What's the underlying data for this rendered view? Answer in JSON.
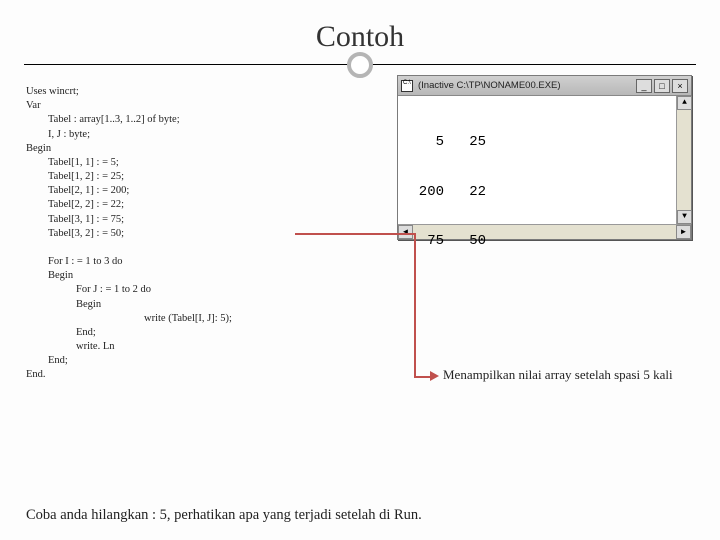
{
  "title": "Contoh",
  "code_lines": [
    {
      "cls": "",
      "text": "Uses wincrt;"
    },
    {
      "cls": "",
      "text": "Var"
    },
    {
      "cls": "ind1",
      "text": "Tabel : array[1..3, 1..2] of byte;"
    },
    {
      "cls": "ind1",
      "text": "I, J : byte;"
    },
    {
      "cls": "",
      "text": "Begin"
    },
    {
      "cls": "ind1",
      "text": "Tabel[1, 1] : = 5;"
    },
    {
      "cls": "ind1",
      "text": "Tabel[1, 2] : = 25;"
    },
    {
      "cls": "ind1",
      "text": "Tabel[2, 1] : = 200;"
    },
    {
      "cls": "ind1",
      "text": "Tabel[2, 2] : = 22;"
    },
    {
      "cls": "ind1",
      "text": "Tabel[3, 1] : = 75;"
    },
    {
      "cls": "ind1",
      "text": "Tabel[3, 2] : = 50;"
    },
    {
      "cls": "",
      "text": " "
    },
    {
      "cls": "ind1",
      "text": "For I : = 1 to 3 do"
    },
    {
      "cls": "ind1",
      "text": "Begin"
    },
    {
      "cls": "ind2",
      "text": "For J : = 1 to 2 do"
    },
    {
      "cls": "ind2",
      "text": "Begin"
    },
    {
      "cls": "ind4",
      "text": "write (Tabel[I, J]: 5);"
    },
    {
      "cls": "ind2",
      "text": "End;"
    },
    {
      "cls": "ind2",
      "text": "write. Ln"
    },
    {
      "cls": "ind1",
      "text": "End;"
    },
    {
      "cls": "",
      "text": "End."
    }
  ],
  "console": {
    "title": "(Inactive C:\\TP\\NONAME00.EXE)",
    "rows": [
      "    5   25",
      "  200   22",
      "   75   50"
    ]
  },
  "caption": "Menampilkan nilai array setelah spasi 5 kali",
  "footer": "Coba anda hilangkan : 5, perhatikan apa yang terjadi setelah di Run.",
  "btn": {
    "min": "_",
    "max": "□",
    "close": "×",
    "left": "◄",
    "right": "►",
    "up": "▲",
    "down": "▼"
  }
}
